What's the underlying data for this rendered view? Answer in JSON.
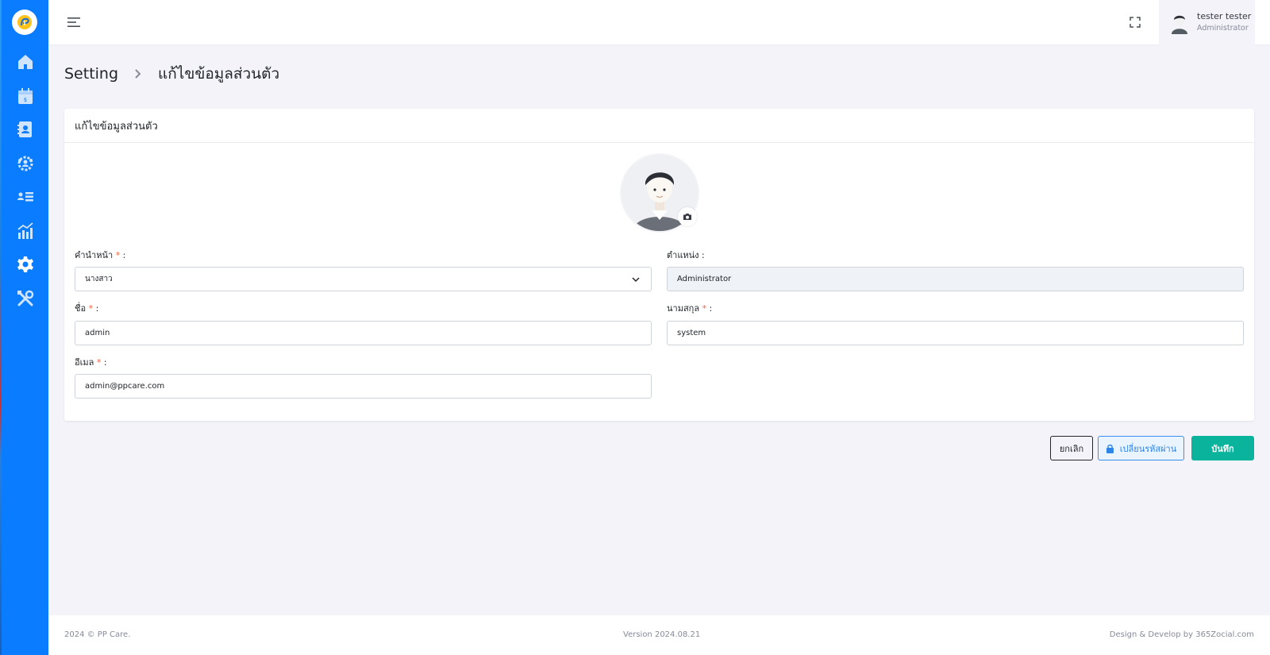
{
  "app": {
    "name": "PP Care"
  },
  "colors": {
    "sidebar": "#0a7cff",
    "primary_save": "#0ab39c",
    "required": "#f06548",
    "password_button": "#2e85e8"
  },
  "sidebar": {
    "logo_icon": "pp-care-logo-icon",
    "items": [
      {
        "icon": "home-icon"
      },
      {
        "icon": "calendar-icon"
      },
      {
        "icon": "contacts-book-icon"
      },
      {
        "icon": "team-settings-icon"
      },
      {
        "icon": "user-list-icon"
      },
      {
        "icon": "analytics-chart-icon"
      },
      {
        "icon": "gear-icon",
        "active": true
      },
      {
        "icon": "tools-icon"
      }
    ]
  },
  "topbar": {
    "menu_icon": "hamburger-icon",
    "fullscreen_icon": "fullscreen-icon",
    "user": {
      "name": "tester tester",
      "role": "Administrator"
    }
  },
  "breadcrumb": {
    "parent": "Setting",
    "current": "แก้ไขข้อมูลส่วนตัว"
  },
  "card": {
    "title": "แก้ไขข้อมูลส่วนตัว",
    "form": {
      "prefix": {
        "label": "คำนำหน้า",
        "value": "นางสาว",
        "required": "*"
      },
      "position": {
        "label": "ตำแหน่ง :",
        "value": "Administrator"
      },
      "first_name": {
        "label": "ชื่อ",
        "value": "admin",
        "required": "*"
      },
      "last_name": {
        "label": "นามสกุล",
        "value": "system",
        "required": "*"
      },
      "email": {
        "label": "อีเมล",
        "value": "admin@ppcare.com",
        "required": "*"
      }
    }
  },
  "actions": {
    "cancel": "ยกเลิก",
    "change_password": "เปลี่ยนรหัสผ่าน",
    "save": "บันทึก"
  },
  "footer": {
    "copyright": "2024 © PP Care.",
    "version": "Version 2024.08.21",
    "credit": "Design & Develop by 365Zocial.com"
  }
}
